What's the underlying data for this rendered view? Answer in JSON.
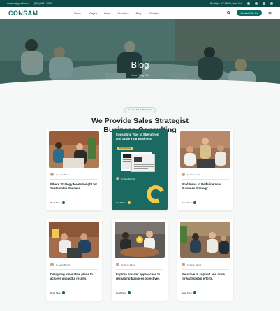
{
  "topbar": {
    "email": "consam@gmail.com",
    "phone": "(000) 445 - 7669",
    "address": "Brooklyn, NY 11200, New York"
  },
  "nav": {
    "logo": "CONSAM",
    "items": [
      "Home",
      "Page",
      "About",
      "Services",
      "Blog",
      "Contact"
    ],
    "cta": "Contact With Us"
  },
  "hero": {
    "title": "Blog",
    "crumb_home": "Home",
    "crumb_sep": "/",
    "crumb_current": "Blog Grid"
  },
  "section": {
    "badge": "LATEST BLOGS",
    "title_line1": "We Provide Sales Strategist",
    "title_line2": "Business Consulting"
  },
  "cards": [
    {
      "author": "by Aaron Bond",
      "title": "Where Strategy Meets Insight for Sustainable Success",
      "more": "Read More",
      "photo": "office-team"
    },
    {
      "featured_title": "Consulting Tips to Strengthen and Scale Your Business",
      "tag": "BEST CHOICE",
      "author": "by Alex Michelle",
      "more": "Read More",
      "photo": "magazine"
    },
    {
      "author": "by Aaron Bond",
      "title": "Bold Ideas to Redefine Your Business Strategy",
      "more": "Read More",
      "photo": "meeting-laptop"
    },
    {
      "author": "by Aaron Barrett",
      "title": "Designing innovative plans to achieve impactful results",
      "more": "Read More",
      "photo": "desk-chat"
    },
    {
      "author": "by Aaron Barrett",
      "title": "Explore smarter approaches to reshaping business objectives",
      "more": "Read More",
      "photo": "boardroom-video"
    },
    {
      "author": "by Aaron Barrett",
      "title": "We strive to support and drive forward global efforts.",
      "more": "Read More",
      "photo": "group-discussion"
    }
  ],
  "colors": {
    "brand": "#0e6b63",
    "accent": "#f2c94c",
    "dark_green": "#0e4b48"
  }
}
